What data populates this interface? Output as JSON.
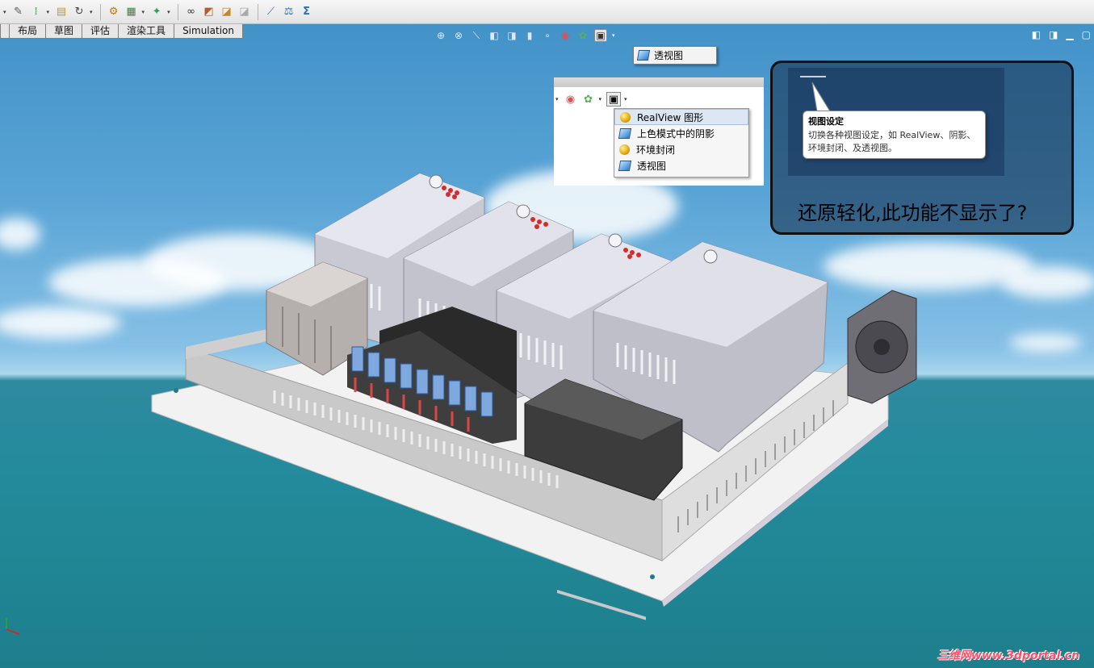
{
  "tabs": [
    "布局",
    "草图",
    "评估",
    "渲染工具",
    "Simulation"
  ],
  "toolbar_icons": [
    "paperclip-icon",
    "green-grip-icon",
    "folder-icon",
    "rebuild-icon",
    "options-gear-icon",
    "assembly-icon",
    "sparkle-icon",
    "search-binoculars-icon",
    "smart-mate-icon",
    "macro-icon",
    "measure-icon",
    "mass-properties-icon",
    "sigma-icon"
  ],
  "flyout_small": {
    "label": "透视图"
  },
  "view_settings_menu": {
    "items": [
      {
        "label": "RealView 图形",
        "icon": "realview-ball-icon"
      },
      {
        "label": "上色模式中的阴影",
        "icon": "shaded-cube-icon"
      },
      {
        "label": "环境封闭",
        "icon": "ambient-occlusion-ball-icon"
      },
      {
        "label": "透视图",
        "icon": "perspective-cube-icon"
      }
    ]
  },
  "tooltip": {
    "title": "视图设定",
    "body": "切换各种视图设定，如 RealView、阴影、环境封闭、及透视图。"
  },
  "callout": {
    "question": "还原轻化,此功能不显示了?"
  },
  "watermark": "三维网www.3dportal.cn",
  "colors": {
    "sky": "#4a98cd",
    "sea": "#238b9c",
    "callout_border": "#111111",
    "watermark": "#ff4e6a"
  }
}
